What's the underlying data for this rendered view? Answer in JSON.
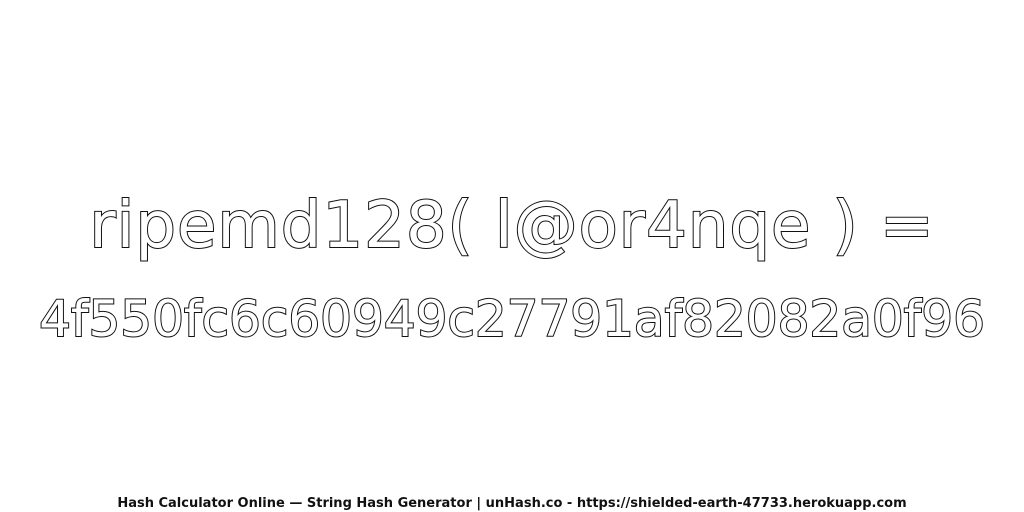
{
  "expression": "ripemd128( l@or4nqe ) =",
  "digest": "4f550fc6c60949c27791af82082a0f96",
  "footer": "Hash Calculator Online — String Hash Generator | unHash.co - https://shielded-earth-47733.herokuapp.com",
  "colors": {
    "background": "#ffffff",
    "text_outline": "#111111",
    "text_fill": "#ffffff"
  }
}
